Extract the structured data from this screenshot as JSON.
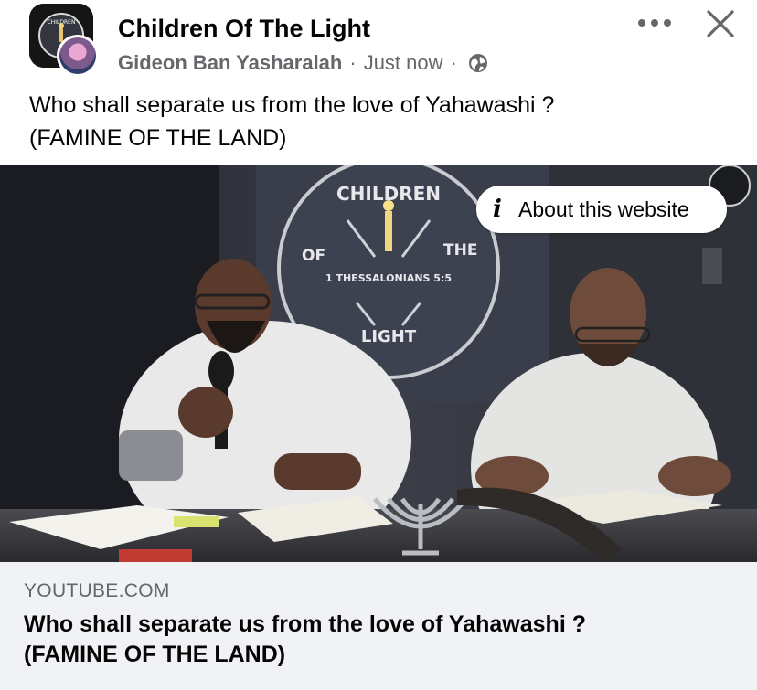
{
  "group": {
    "name": "Children Of The Light",
    "avatar_icon": "group-logo-icon",
    "logo_text": "CHILDREN"
  },
  "post": {
    "author": "Gideon Ban Yasharalah",
    "separator": "·",
    "timestamp": "Just now",
    "audience_icon": "globe-icon",
    "text_line1": "Who shall separate us from the love of Yahawashi ?",
    "text_line2": "(FAMINE OF THE LAND)"
  },
  "actions": {
    "more_icon": "more-options-icon",
    "close_icon": "close-icon"
  },
  "media": {
    "about_label": "About this website",
    "banner": {
      "top": "CHILDREN",
      "left": "OF",
      "right": "THE",
      "verse": "1 THESSALONIANS 5:5",
      "bottom": "LIGHT"
    }
  },
  "link": {
    "domain": "YOUTUBE.COM",
    "title_line1": "Who shall separate us from the love of Yahawashi ?",
    "title_line2": "(FAMINE OF THE LAND)"
  },
  "colors": {
    "text_primary": "#050505",
    "text_secondary": "#65676b",
    "link_bg": "#f0f2f5"
  }
}
